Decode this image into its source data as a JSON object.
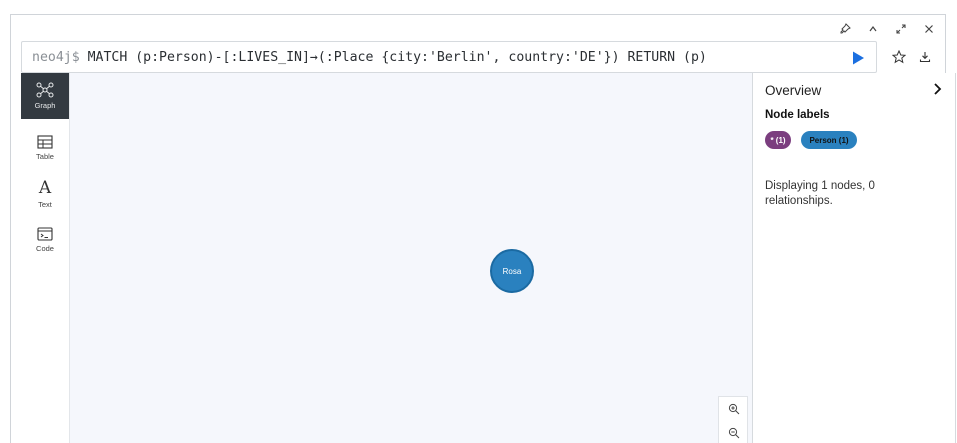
{
  "frame": {
    "controls": [
      {
        "name": "pin-icon",
        "glyph": "⚲"
      },
      {
        "name": "collapse-up-icon",
        "glyph": "^"
      },
      {
        "name": "fullscreen-icon",
        "glyph": "⤢"
      },
      {
        "name": "close-icon",
        "glyph": "✕"
      }
    ]
  },
  "editor": {
    "prompt": "neo4j$",
    "query": " MATCH (p:Person)-[:LIVES_IN]→(:Place {city:'Berlin', country:'DE'}) RETURN (p)",
    "run_color": "#1b6fe0"
  },
  "sidebar": {
    "items": [
      {
        "label": "Graph",
        "icon": "graph-icon",
        "active": true
      },
      {
        "label": "Table",
        "icon": "table-icon",
        "active": false
      },
      {
        "label": "Text",
        "icon": "text-icon",
        "active": false
      },
      {
        "label": "Code",
        "icon": "code-icon",
        "active": false
      }
    ]
  },
  "graph": {
    "nodes": [
      {
        "label": "Rosa",
        "color": "#2a81bf"
      }
    ]
  },
  "panel": {
    "title": "Overview",
    "labels_heading": "Node labels",
    "pills": [
      {
        "text": "* (1)",
        "color": "#7b3e7f"
      },
      {
        "text": "Person (1)",
        "color": "#2a81bf"
      }
    ],
    "summary": "Displaying 1 nodes, 0 relationships."
  }
}
